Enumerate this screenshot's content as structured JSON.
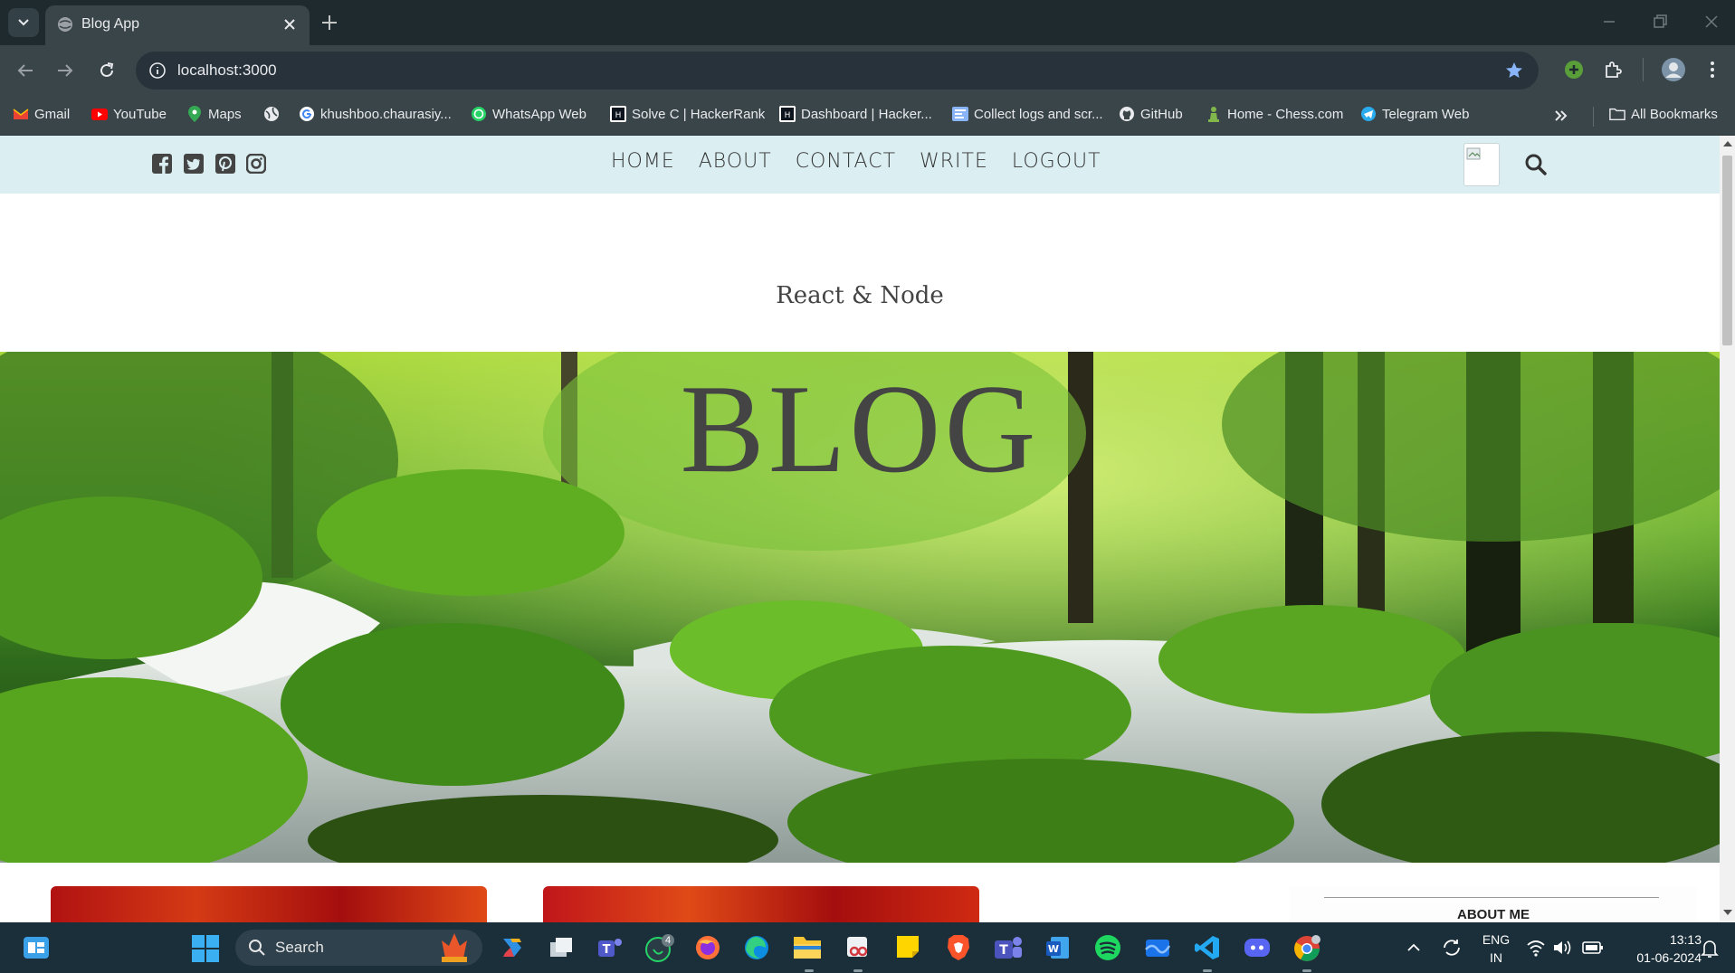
{
  "browser": {
    "tab_title": "Blog App",
    "url": "localhost:3000",
    "bookmarks": [
      {
        "label": "Gmail",
        "icon": "gmail-icon"
      },
      {
        "label": "YouTube",
        "icon": "youtube-icon"
      },
      {
        "label": "Maps",
        "icon": "maps-icon"
      },
      {
        "label": "",
        "icon": "globe-icon"
      },
      {
        "label": "khushboo.chaurasiy...",
        "icon": "google-icon"
      },
      {
        "label": "WhatsApp Web",
        "icon": "whatsapp-icon"
      },
      {
        "label": "Solve C | HackerRank",
        "icon": "hackerrank-icon"
      },
      {
        "label": "Dashboard | Hacker...",
        "icon": "hackerrank-icon"
      },
      {
        "label": "Collect logs and scr...",
        "icon": "logs-icon"
      },
      {
        "label": "GitHub",
        "icon": "github-icon"
      },
      {
        "label": "Home - Chess.com",
        "icon": "chess-icon"
      },
      {
        "label": "Telegram Web",
        "icon": "telegram-icon"
      }
    ],
    "all_bookmarks": "All Bookmarks"
  },
  "site": {
    "nav": [
      "HOME",
      "ABOUT",
      "CONTACT",
      "WRITE",
      "LOGOUT"
    ],
    "social": [
      "facebook-icon",
      "twitter-icon",
      "pinterest-icon",
      "instagram-icon"
    ],
    "header_subtitle": "React & Node",
    "header_title": "BLOG",
    "sidebar_title": "ABOUT ME"
  },
  "taskbar": {
    "search_label": "Search",
    "whatsapp_badge": "4",
    "lang_top": "ENG",
    "lang_bottom": "IN",
    "time": "13:13",
    "date": "01-06-2024"
  },
  "colors": {
    "nav_bg": "#dbeff3",
    "chrome_bg": "#3a4549",
    "taskbar_bg": "#1b2f3a"
  }
}
